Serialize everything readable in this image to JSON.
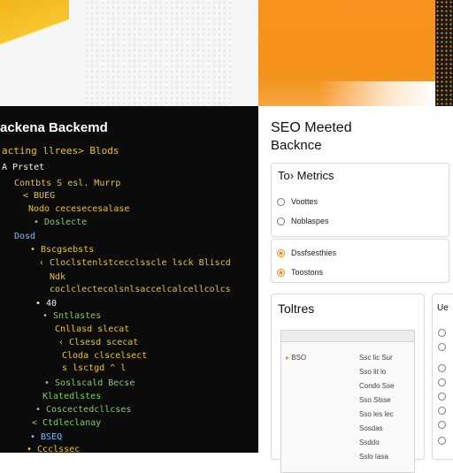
{
  "code_panel": {
    "title": "ackena Backemd",
    "subtitle": "acting llrees>  Blods",
    "lines": [
      {
        "text": "A Prstet",
        "color": "w"
      },
      {
        "text": "Contbts  S esl. Murrp",
        "color": "y"
      },
      {
        "text": "< BUEG",
        "color": "y"
      },
      {
        "text": "Nodo  cecesecesalase",
        "color": "y"
      },
      {
        "text": "• Doslecte",
        "color": "g"
      },
      {
        "text": "Dosd",
        "color": "b"
      },
      {
        "text": "• Bscgsebsts",
        "color": "y"
      },
      {
        "text": "‹ Cloclstenlstcecclsscle lsck  Bliscd",
        "color": "y"
      },
      {
        "text": "Ndk",
        "color": "y"
      },
      {
        "text": "coclclectecolsnlsaccelcalcellcolcs",
        "color": "y"
      },
      {
        "text": "• 40",
        "color": "w"
      },
      {
        "text": "• Sntlastes",
        "color": "g"
      },
      {
        "text": "Cnllasd slecat",
        "color": "y"
      },
      {
        "text": "‹ Clsesd scecat",
        "color": "y"
      },
      {
        "text": "Cloda clscelsect",
        "color": "y"
      },
      {
        "text": "s lsctgd   ^   l",
        "color": "y"
      },
      {
        "text": "• Soslscald Becse",
        "color": "g"
      },
      {
        "text": "Klatedlstes",
        "color": "g"
      },
      {
        "text": "• Coscectedcllcses",
        "color": "g"
      },
      {
        "text": "< Ctdleclanay",
        "color": "g"
      },
      {
        "text": "• BSEQ",
        "color": "b"
      },
      {
        "text": "• Ccclssec",
        "color": "y"
      }
    ]
  },
  "app": {
    "title": "SEO Meeted",
    "subtitle": "Backnce"
  },
  "metrics_card": {
    "title": "To› Metrics",
    "items": [
      {
        "label": "Voottes",
        "selected": false
      },
      {
        "label": "Noblaspes",
        "selected": false
      }
    ]
  },
  "second_card": {
    "items": [
      {
        "label": "Dssfsesthies",
        "selected": true
      },
      {
        "label": "Toostons",
        "selected": true
      }
    ]
  },
  "tools_card": {
    "title": "Toltres",
    "first_row": "BSO",
    "right_cells": [
      "Ssc lic Sur",
      "Sso lit lo",
      "Condo Sse",
      "Sso Slsse",
      "Sso les lec",
      "Sosdas",
      "Ssddo",
      "Sslo Iasa"
    ]
  },
  "side_card": {
    "title": "Ue"
  },
  "colors": {
    "accent": "#f39219",
    "code_bg": "#0b0b0b",
    "code_yellow": "#e8c22d",
    "code_green": "#7fcf62"
  }
}
